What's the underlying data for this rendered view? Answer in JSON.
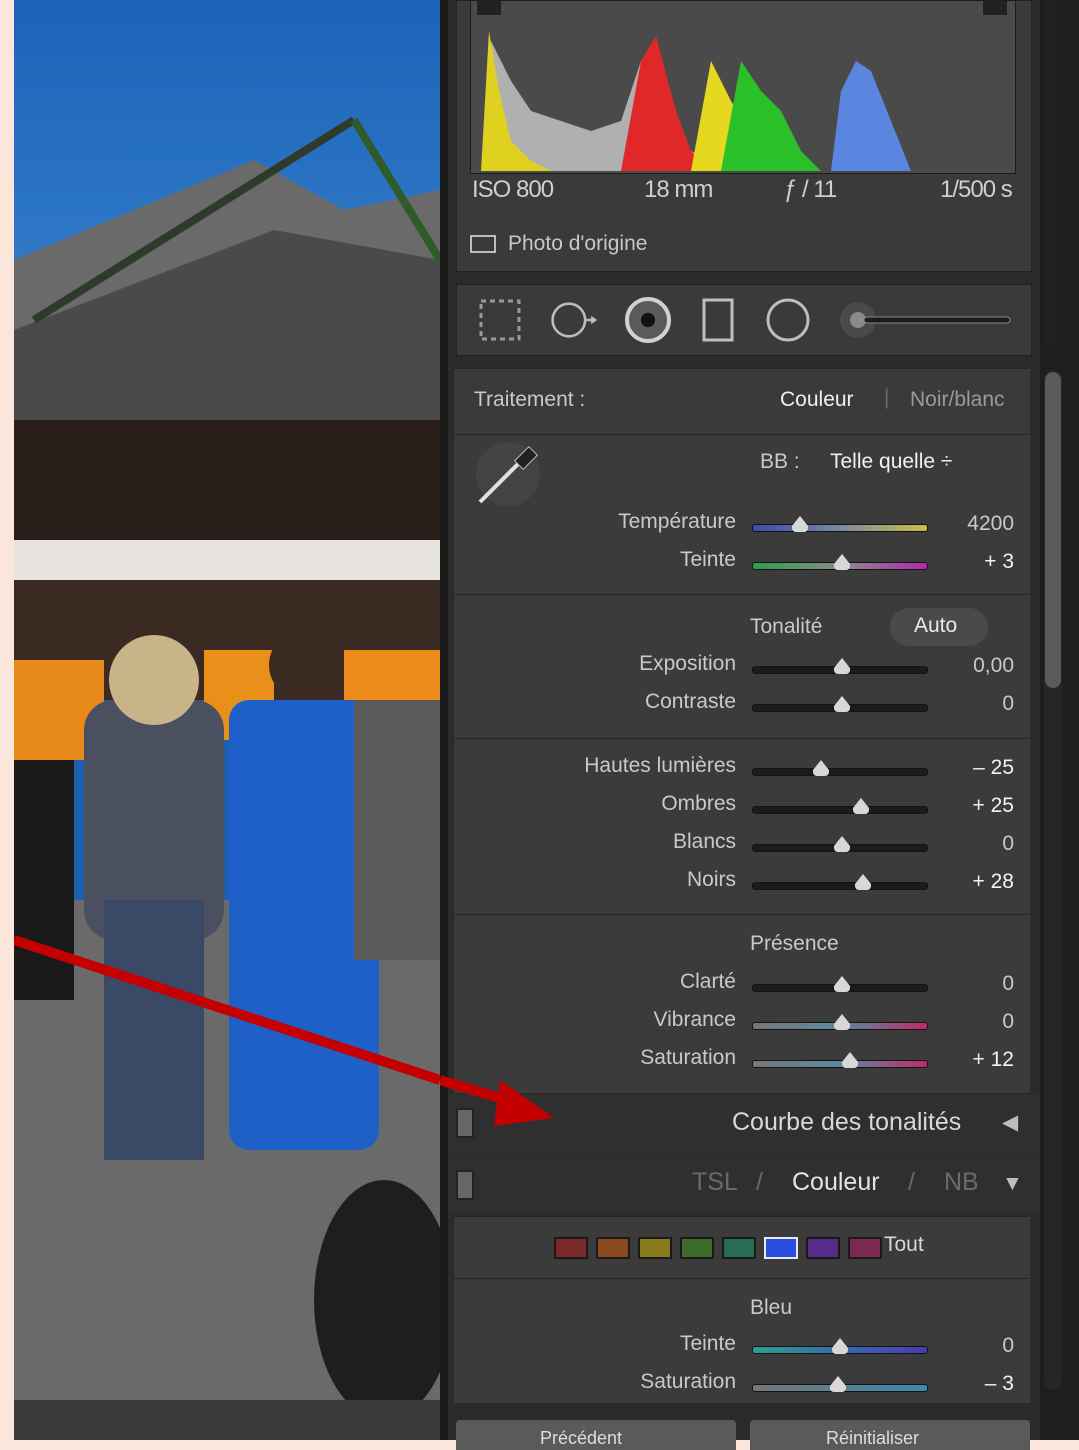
{
  "histogram": {
    "exif": {
      "iso": "ISO 800",
      "focal": "18 mm",
      "aperture": "ƒ / 11",
      "shutter": "1/500 s"
    },
    "original_photo_label": "Photo d'origine"
  },
  "treatment": {
    "label": "Traitement :",
    "option_color": "Couleur",
    "separator": "|",
    "option_bw": "Noir/blanc"
  },
  "white_balance": {
    "label": "BB :",
    "value": "Telle quelle ÷",
    "sliders": [
      {
        "label": "Température",
        "value": "4200",
        "position": 0.27
      },
      {
        "label": "Teinte",
        "value": "+ 3",
        "position": 0.51
      }
    ]
  },
  "tone": {
    "title": "Tonalité",
    "auto_label": "Auto",
    "sliders": [
      {
        "label": "Exposition",
        "value": "0,00",
        "position": 0.51
      },
      {
        "label": "Contraste",
        "value": "0",
        "position": 0.51
      }
    ],
    "sliders2": [
      {
        "label": "Hautes lumières",
        "value": "– 25",
        "position": 0.39
      },
      {
        "label": "Ombres",
        "value": "+ 25",
        "position": 0.62
      },
      {
        "label": "Blancs",
        "value": "0",
        "position": 0.51
      },
      {
        "label": "Noirs",
        "value": "+ 28",
        "position": 0.63
      }
    ]
  },
  "presence": {
    "title": "Présence",
    "sliders": [
      {
        "label": "Clarté",
        "value": "0",
        "position": 0.51
      },
      {
        "label": "Vibrance",
        "value": "0",
        "position": 0.51
      },
      {
        "label": "Saturation",
        "value": "+ 12",
        "position": 0.56
      }
    ]
  },
  "tone_curve": {
    "title": "Courbe des tonalités",
    "arrow": "◀"
  },
  "hsl": {
    "tab_tsl": "TSL",
    "sep1": "/",
    "tab_color": "Couleur",
    "sep2": "/",
    "tab_nb": "NB",
    "arrow": "▼",
    "all_label": "Tout",
    "swatch_colors": [
      "#7a2a2a",
      "#8a4a22",
      "#8a7a1e",
      "#3f6b2a",
      "#2a6b55",
      "#2a4fe0",
      "#5a2a8a",
      "#7a2a50"
    ],
    "selected_title": "Bleu",
    "sliders": [
      {
        "label": "Teinte",
        "value": "0",
        "position": 0.5
      },
      {
        "label": "Saturation",
        "value": "– 3",
        "position": 0.49
      }
    ]
  },
  "bottom_buttons": {
    "previous": "Précédent",
    "reset": "Réinitialiser"
  },
  "colors": {
    "accent_arrow": "#c40000"
  }
}
